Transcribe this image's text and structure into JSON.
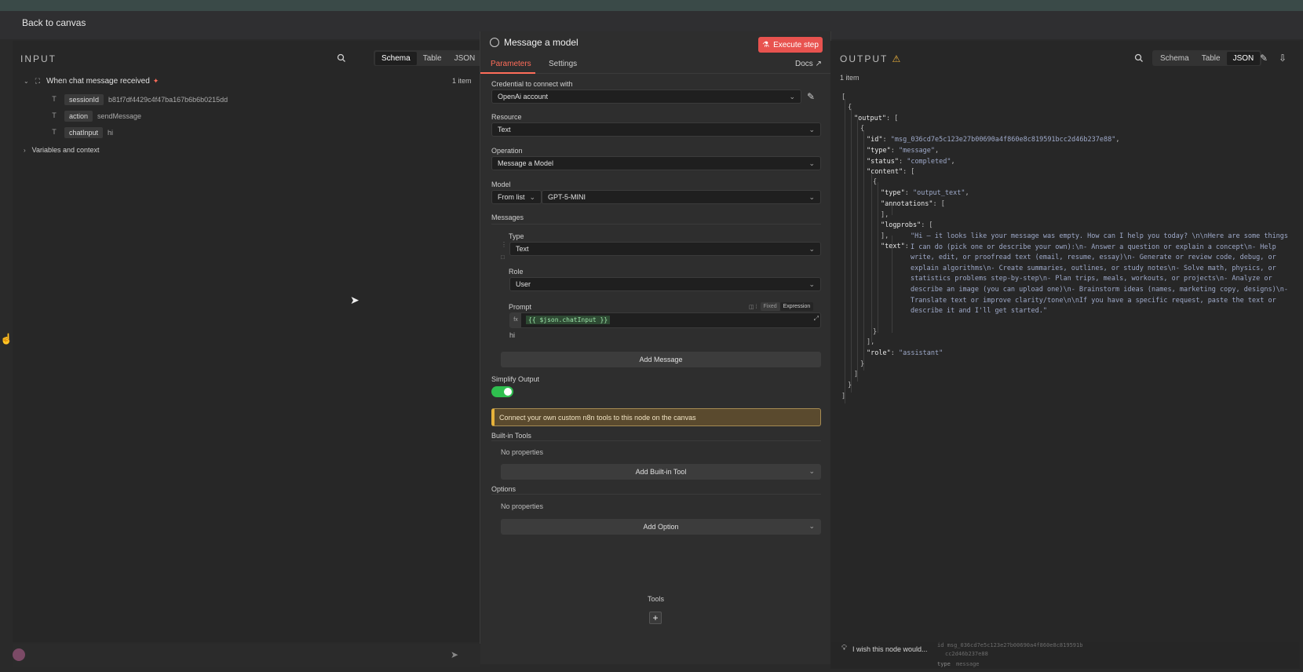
{
  "header": {
    "back_label": "Back to canvas"
  },
  "input": {
    "title": "INPUT",
    "view_tabs": [
      "Schema",
      "Table",
      "JSON"
    ],
    "active_tab": "Schema",
    "trigger_label": "When chat message received",
    "item_count": "1 item",
    "fields": [
      {
        "type_icon": "T",
        "key": "sessionId",
        "value": "b81f7df4429c4f47ba167b6b6b0215dd"
      },
      {
        "type_icon": "T",
        "key": "action",
        "value": "sendMessage"
      },
      {
        "type_icon": "T",
        "key": "chatInput",
        "value": "hi"
      }
    ],
    "variables_label": "Variables and context"
  },
  "node": {
    "title": "Message a model",
    "execute_label": "Execute step",
    "tabs": [
      "Parameters",
      "Settings"
    ],
    "docs_label": "Docs",
    "credential_label": "Credential to connect with",
    "credential_value": "OpenAi account",
    "resource_label": "Resource",
    "resource_value": "Text",
    "operation_label": "Operation",
    "operation_value": "Message a Model",
    "model_label": "Model",
    "model_mode": "From list",
    "model_value": "GPT-5-MINI",
    "messages_label": "Messages",
    "msg_type_label": "Type",
    "msg_type_value": "Text",
    "role_label": "Role",
    "role_value": "User",
    "prompt_label": "Prompt",
    "prompt_fixed": "Fixed",
    "prompt_expression": "Expression",
    "prompt_value": "{{ $json.chatInput }}",
    "prompt_preview": "hi",
    "add_message_label": "Add Message",
    "simplify_label": "Simplify Output",
    "simplify_on": true,
    "tools_notice": "Connect your own custom n8n tools to this node on the canvas",
    "builtin_label": "Built-in Tools",
    "no_props_1": "No properties",
    "add_builtin_label": "Add Built-in Tool",
    "options_label": "Options",
    "no_props_2": "No properties",
    "add_option_label": "Add Option",
    "tools_footer_label": "Tools",
    "colors": {
      "accent": "#ff6d5a",
      "execute": "#e8534f",
      "toggle": "#2fbf4f"
    }
  },
  "output": {
    "title": "OUTPUT",
    "view_tabs": [
      "Schema",
      "Table",
      "JSON"
    ],
    "active_tab": "JSON",
    "item_count": "1 item",
    "json_lines": {
      "l1": "[",
      "l2": "{",
      "l3_key": "\"output\"",
      "l3_rest": ": [",
      "l4": "{",
      "id_key": "\"id\"",
      "id_val": "\"msg_036cd7e5c123e27b00690a4f860e8c819591bcc2d46b237e88\"",
      "type_key": "\"type\"",
      "type_val": "\"message\"",
      "status_key": "\"status\"",
      "status_val": "\"completed\"",
      "content_key": "\"content\"",
      "content_rest": ": [",
      "c_open": "{",
      "ctype_key": "\"type\"",
      "ctype_val": "\"output_text\"",
      "ann_key": "\"annotations\"",
      "ann_rest": ": [",
      "ann_close": "],",
      "log_key": "\"logprobs\"",
      "log_rest": ": [",
      "log_close": "],",
      "text_key": "\"text\"",
      "text_val": "\"Hi — it looks like your message was empty. How can I help you today? \\n\\nHere are some things I can do (pick one or describe your own):\\n- Answer a question or explain a concept\\n- Help write, edit, or proofread text (email, resume, essay)\\n- Generate or review code, debug, or explain algorithms\\n- Create summaries, outlines, or study notes\\n- Solve math, physics, or statistics problems step-by-step\\n- Plan trips, meals, workouts, or projects\\n- Analyze or describe an image (you can upload one)\\n- Brainstorm ideas (names, marketing copy, designs)\\n- Translate text or improve clarity/tone\\n\\nIf you have a specific request, paste the text or describe it and I'll get started.\"",
      "c_close": "}",
      "content_close": "],",
      "role_key": "\"role\"",
      "role_val": "\"assistant\"",
      "o_close": "}",
      "output_close": "]",
      "root_item_close": "}",
      "root_close": "]"
    },
    "feedback_label": "I wish this node would...",
    "peek_line1": "id  msg_036cd7e5c123e27b00690a4f860e8c819591b",
    "peek_line2": "cc2d46b237e88",
    "peek_line3_key": "type",
    "peek_line3_val": "message"
  }
}
